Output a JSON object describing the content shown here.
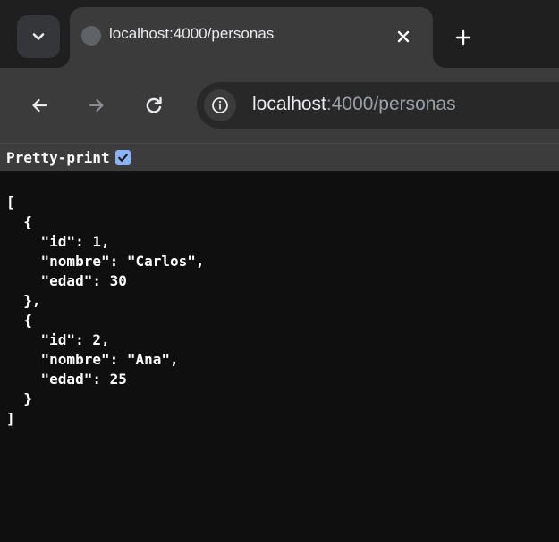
{
  "colors": {
    "tabstrip_bg": "#1f1f1f",
    "toolbar_bg": "#3b3b3b",
    "omnibox_bg": "#282828",
    "page_bg": "#0f0f0f",
    "checkbox_accent": "#8ab4f8"
  },
  "tab": {
    "title": "localhost:4000/personas",
    "favicon": "globe-icon",
    "close_icon": "close-icon"
  },
  "toolbar": {
    "back_icon": "arrow-left-icon",
    "forward_icon": "arrow-right-icon",
    "reload_icon": "reload-icon",
    "site_info_icon": "info-icon",
    "url_host": "localhost",
    "url_rest": ":4000/personas"
  },
  "pretty_print": {
    "label": "Pretty-print",
    "checked": true
  },
  "json_lines": [
    "[",
    "  {",
    "    \"id\": 1,",
    "    \"nombre\": \"Carlos\",",
    "    \"edad\": 30",
    "  },",
    "  {",
    "    \"id\": 2,",
    "    \"nombre\": \"Ana\",",
    "    \"edad\": 25",
    "  }",
    "]"
  ]
}
